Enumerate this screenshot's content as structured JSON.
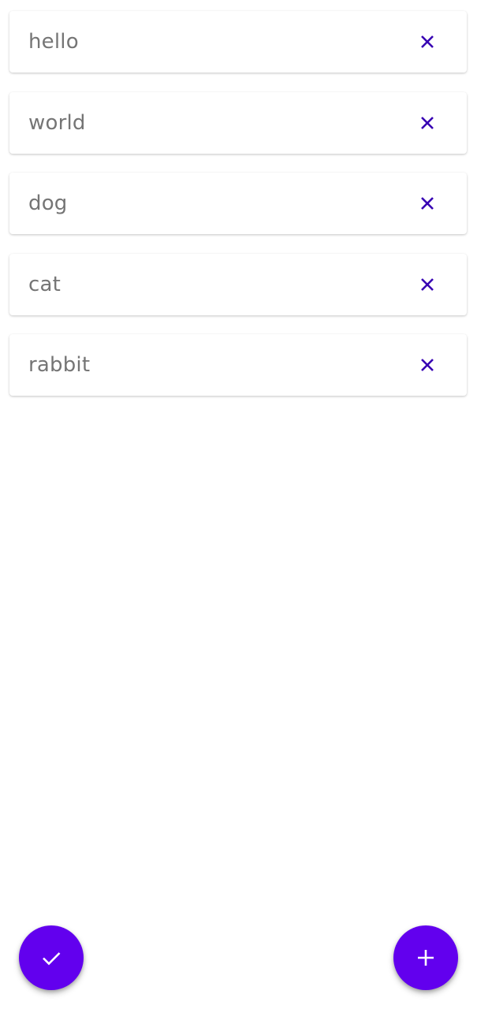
{
  "items": [
    {
      "label": "hello",
      "close_icon": "close-icon"
    },
    {
      "label": "world",
      "close_icon": "close-icon"
    },
    {
      "label": "dog",
      "close_icon": "close-icon"
    },
    {
      "label": "cat",
      "close_icon": "close-icon"
    },
    {
      "label": "rabbit",
      "close_icon": "close-icon"
    }
  ],
  "fabs": {
    "confirm_icon": "check-icon",
    "add_icon": "plus-icon"
  },
  "colors": {
    "accent": "#6200ee",
    "close_icon": "#3700b3",
    "label_text": "#757575",
    "background": "#ffffff"
  }
}
